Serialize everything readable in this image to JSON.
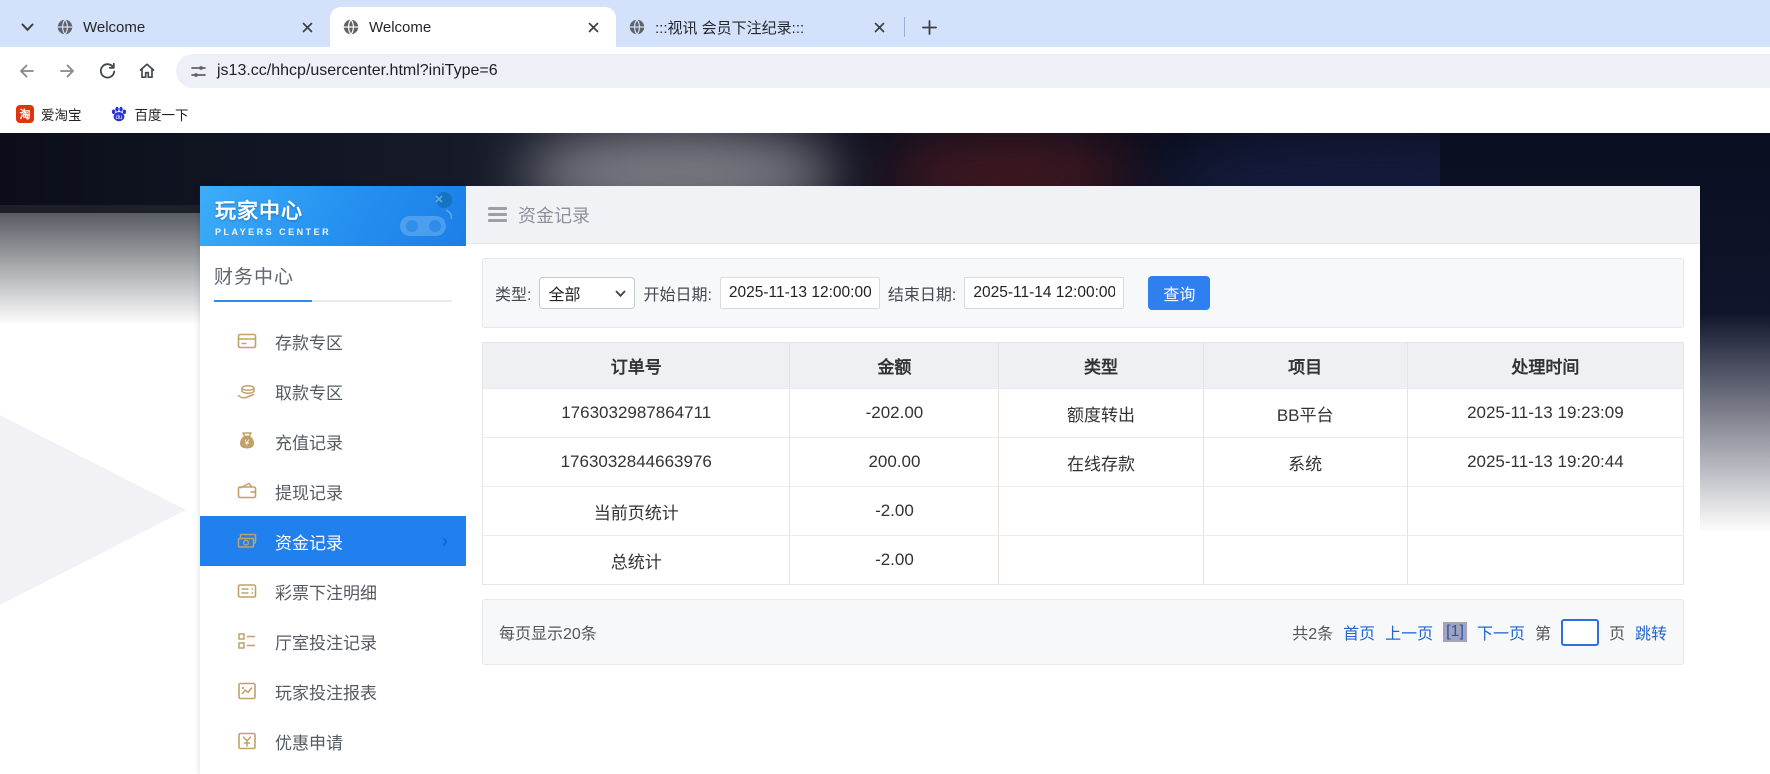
{
  "browser": {
    "tabs": [
      {
        "label": "Welcome"
      },
      {
        "label": "Welcome"
      },
      {
        "label": ":::视讯 会员下注纪录:::"
      }
    ],
    "url": "js13.cc/hhcp/usercenter.html?iniType=6",
    "bookmarks": [
      {
        "label": "爱淘宝",
        "icon_char": "淘"
      },
      {
        "label": "百度一下"
      }
    ]
  },
  "sidebar": {
    "title": "玩家中心",
    "subtitle": "PLAYERS CENTER",
    "section": "财务中心",
    "items": [
      {
        "label": "存款专区"
      },
      {
        "label": "取款专区"
      },
      {
        "label": "充值记录"
      },
      {
        "label": "提现记录"
      },
      {
        "label": "资金记录",
        "active": true,
        "chevron": "›"
      },
      {
        "label": "彩票下注明细"
      },
      {
        "label": "厅室投注记录"
      },
      {
        "label": "玩家投注报表"
      },
      {
        "label": "优惠申请"
      }
    ]
  },
  "main": {
    "header_title": "资金记录",
    "filters": {
      "type_label": "类型:",
      "type_value": "全部",
      "start_label": "开始日期:",
      "start_value": "2025-11-13 12:00:00",
      "end_label": "结束日期:",
      "end_value": "2025-11-14 12:00:00",
      "query_label": "查询"
    },
    "table": {
      "headers": [
        "订单号",
        "金额",
        "类型",
        "项目",
        "处理时间"
      ],
      "rows": [
        [
          "1763032987864711",
          "-202.00",
          "额度转出",
          "BB平台",
          "2025-11-13 19:23:09"
        ],
        [
          "1763032844663976",
          "200.00",
          "在线存款",
          "系统",
          "2025-11-13 19:20:44"
        ],
        [
          "当前页统计",
          "-2.00",
          "",
          "",
          ""
        ],
        [
          "总统计",
          "-2.00",
          "",
          "",
          ""
        ]
      ]
    },
    "pagination": {
      "per_page": "每页显示20条",
      "total": "共2条",
      "first": "首页",
      "prev": "上一页",
      "current": "[1]",
      "next": "下一页",
      "jump_prefix": "第",
      "jump_value": "",
      "jump_suffix": "页",
      "jump_go": "跳转"
    }
  },
  "colors": {
    "tabstrip_bg": "#d3e1fb",
    "banner_blue_start": "#3dadf8",
    "banner_blue_end": "#1b7ee7",
    "active_menu_blue": "#2080ee",
    "gold_icon": "#c2a06a",
    "query_button_blue": "#2e7ff0",
    "link_blue": "#2166cf",
    "current_page_bg": "#a5a3b5",
    "taobao_red": "#e2330e",
    "baidu_blue": "#2833dd"
  }
}
